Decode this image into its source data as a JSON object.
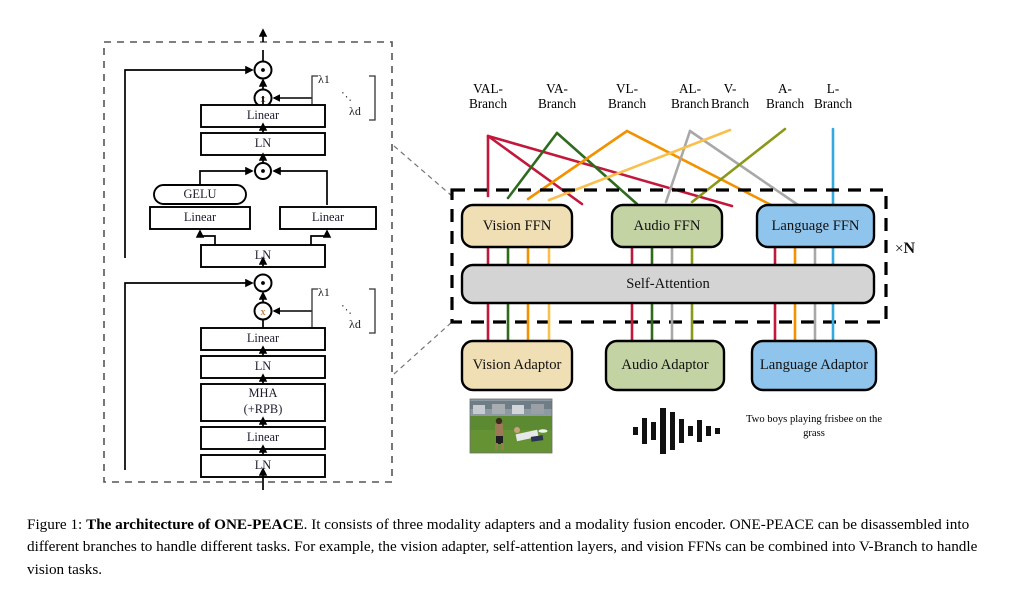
{
  "figure": {
    "caption_prefix": "Figure 1: ",
    "caption_bold": "The architecture of ONE-PEACE",
    "caption_rest": ". It consists of three modality adapters and a modality fusion encoder. ONE-PEACE can be disassembled into different branches to handle different tasks. For example, the vision adapter, self-attention layers, and vision FFNs can be combined into V-Branch to handle vision tasks."
  },
  "left_panel": {
    "title": "transformer-block-detail",
    "ffn_sublayer": {
      "add_symbol": "+",
      "scale_symbol": "×",
      "lambda_first": "λ1",
      "lambda_last": "λd",
      "lambda_dots": "⋱",
      "linear_out": "Linear",
      "ln_out": "LN",
      "product_symbol": "⊙",
      "gelu": "GELU",
      "linear_gate": "Linear",
      "linear_value": "Linear",
      "ln_in": "LN"
    },
    "attn_sublayer": {
      "add_symbol": "+",
      "scale_symbol": "×",
      "lambda_first": "λ1",
      "lambda_last": "λd",
      "lambda_dots": "⋱",
      "linear_out": "Linear",
      "ln_out": "LN",
      "mha_line1": "MHA",
      "mha_line2": "(+RPB)",
      "linear_in": "Linear",
      "ln_in": "LN"
    }
  },
  "right_panel": {
    "branches": [
      {
        "id": "val",
        "line1": "VAL-",
        "line2": "Branch",
        "color": "#c2183c"
      },
      {
        "id": "va",
        "line1": "VA-",
        "line2": "Branch",
        "color": "#2e6b1f"
      },
      {
        "id": "vl",
        "line1": "VL-",
        "line2": "Branch",
        "color": "#f39200"
      },
      {
        "id": "al",
        "line1": "AL-",
        "line2": "Branch",
        "color": "#a8a8a8"
      },
      {
        "id": "v",
        "line1": "V-",
        "line2": "Branch",
        "color": "#fac04e"
      },
      {
        "id": "a",
        "line1": "A-",
        "line2": "Branch",
        "color": "#8b991a"
      },
      {
        "id": "l",
        "line1": "L-",
        "line2": "Branch",
        "color": "#33a9e0"
      }
    ],
    "ffn_boxes": [
      {
        "id": "vision",
        "label": "Vision FFN",
        "fill": "#f0deb4"
      },
      {
        "id": "audio",
        "label": "Audio FFN",
        "fill": "#c3d3a4"
      },
      {
        "id": "language",
        "label": "Language FFN",
        "fill": "#8fc5ec"
      }
    ],
    "self_attention": {
      "label": "Self-Attention",
      "fill": "#d4d4d4"
    },
    "repeat_label_times": "×",
    "repeat_label_n": "N",
    "adaptors": [
      {
        "id": "vision",
        "label": "Vision Adaptor",
        "fill": "#f0deb4"
      },
      {
        "id": "audio",
        "label": "Audio Adaptor",
        "fill": "#c3d3a4"
      },
      {
        "id": "language",
        "label": "Language Adaptor",
        "fill": "#8fc5ec"
      }
    ],
    "examples": {
      "vision_alt": "photo of two boys playing frisbee on grass",
      "audio_alt": "audio waveform",
      "language_text": "Two boys playing frisbee on the grass"
    }
  },
  "colors": {
    "crimson": "#c2183c",
    "darkgreen": "#2e6b1f",
    "orange": "#f39200",
    "gray": "#a8a8a8",
    "lightorange": "#fac04e",
    "olive": "#8b991a",
    "blue": "#33a9e0",
    "vision_fill": "#f0deb4",
    "audio_fill": "#c3d3a4",
    "language_fill": "#8fc5ec",
    "attention_fill": "#d4d4d4",
    "stroke": "#000000"
  }
}
